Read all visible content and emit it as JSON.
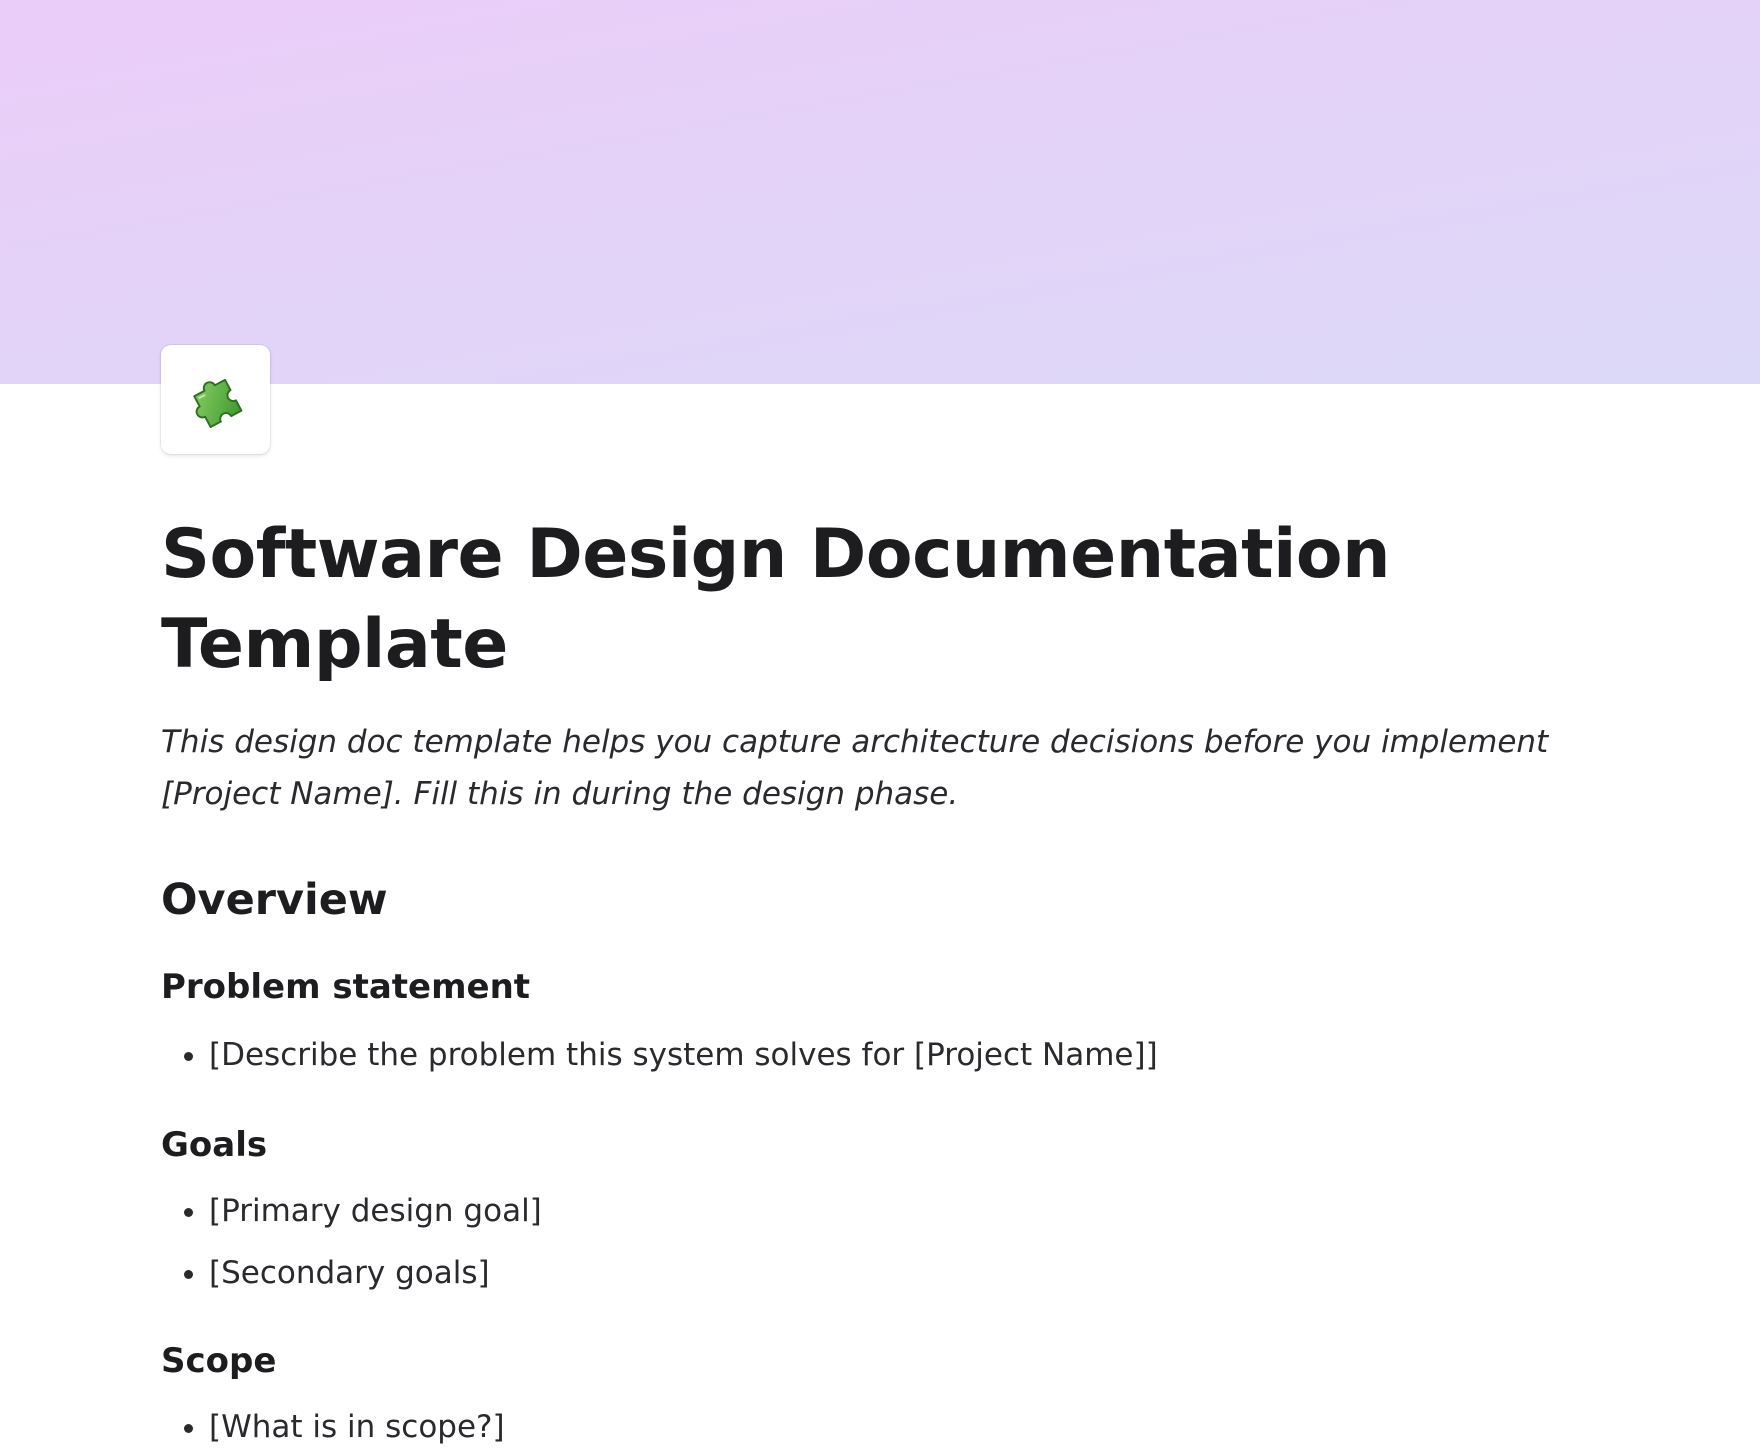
{
  "page": {
    "icon": "puzzle-piece-icon",
    "cover_colors": [
      "#ebcdf9",
      "#dcd9f8"
    ],
    "title": "Software Design Documentation Template",
    "subtitle": "This design doc template helps you capture architecture decisions before you implement [Project Name]. Fill this in during the design phase."
  },
  "overview": {
    "heading": "Overview",
    "problem": {
      "heading": "Problem statement",
      "items": [
        "[Describe the problem this system solves for [Project Name]]"
      ]
    },
    "goals": {
      "heading": "Goals",
      "items": [
        "[Primary design goal]",
        "[Secondary goals]"
      ]
    },
    "scope": {
      "heading": "Scope",
      "items": [
        "[What is in scope?]"
      ]
    }
  }
}
